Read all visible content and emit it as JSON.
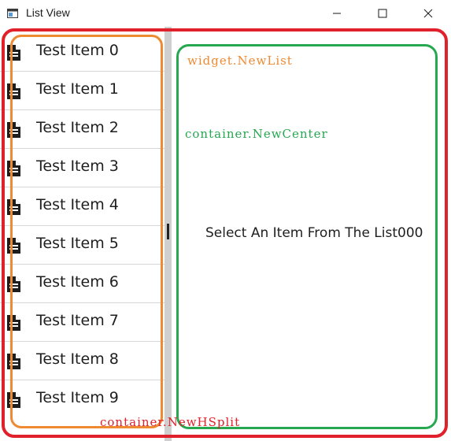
{
  "window": {
    "title": "List View",
    "icon": "app-window-icon",
    "controls": {
      "minimize_icon": "minimize-icon",
      "maximize_icon": "maximize-icon",
      "close_icon": "close-icon"
    }
  },
  "list": {
    "item_icon": "document-icon",
    "items": [
      {
        "label": "Test Item 0"
      },
      {
        "label": "Test Item 1"
      },
      {
        "label": "Test Item 2"
      },
      {
        "label": "Test Item 3"
      },
      {
        "label": "Test Item 4"
      },
      {
        "label": "Test Item 5"
      },
      {
        "label": "Test Item 6"
      },
      {
        "label": "Test Item 7"
      },
      {
        "label": "Test Item 8"
      },
      {
        "label": "Test Item 9"
      }
    ]
  },
  "center": {
    "message": "Select An Item From The List000"
  },
  "annotations": {
    "list_label": "widget.NewList",
    "center_label": "container.NewCenter",
    "hsplit_label": "container.NewHSplit",
    "colors": {
      "hsplit": "#e0202a",
      "list": "#ee8a32",
      "center": "#25a84f"
    }
  }
}
